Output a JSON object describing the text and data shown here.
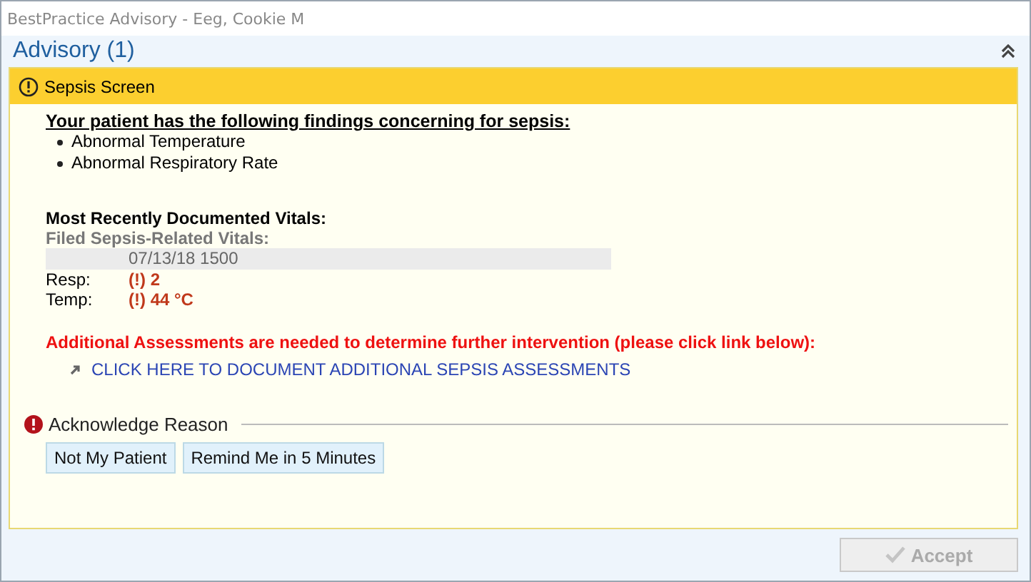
{
  "window": {
    "title": "BestPractice Advisory - Eeg, Cookie M"
  },
  "advisory": {
    "title": "Advisory (1)",
    "expanded": true
  },
  "alert": {
    "title": "Sepsis Screen",
    "heading": "Your patient has the following findings concerning for sepsis:",
    "findings": [
      "Abnormal Temperature",
      "Abnormal Respiratory Rate"
    ],
    "vitals_heading": "Most Recently Documented Vitals:",
    "filed_heading": "Filed Sepsis-Related Vitals:",
    "timestamp": "07/13/18 1500",
    "vitals": [
      {
        "label": "Resp:",
        "value": "(!) 2"
      },
      {
        "label": "Temp:",
        "value": "(!) 44 °C"
      }
    ],
    "warning": "Additional Assessments are needed to determine further intervention (please click link below):",
    "link": "CLICK HERE TO DOCUMENT ADDITIONAL SEPSIS ASSESSMENTS"
  },
  "acknowledge": {
    "title": "Acknowledge Reason",
    "options": [
      {
        "label": "Not My Patient",
        "selected": false
      },
      {
        "label": "Remind Me in 5 Minutes",
        "selected": false
      }
    ]
  },
  "accept_button": {
    "label": "Accept",
    "disabled": true
  }
}
